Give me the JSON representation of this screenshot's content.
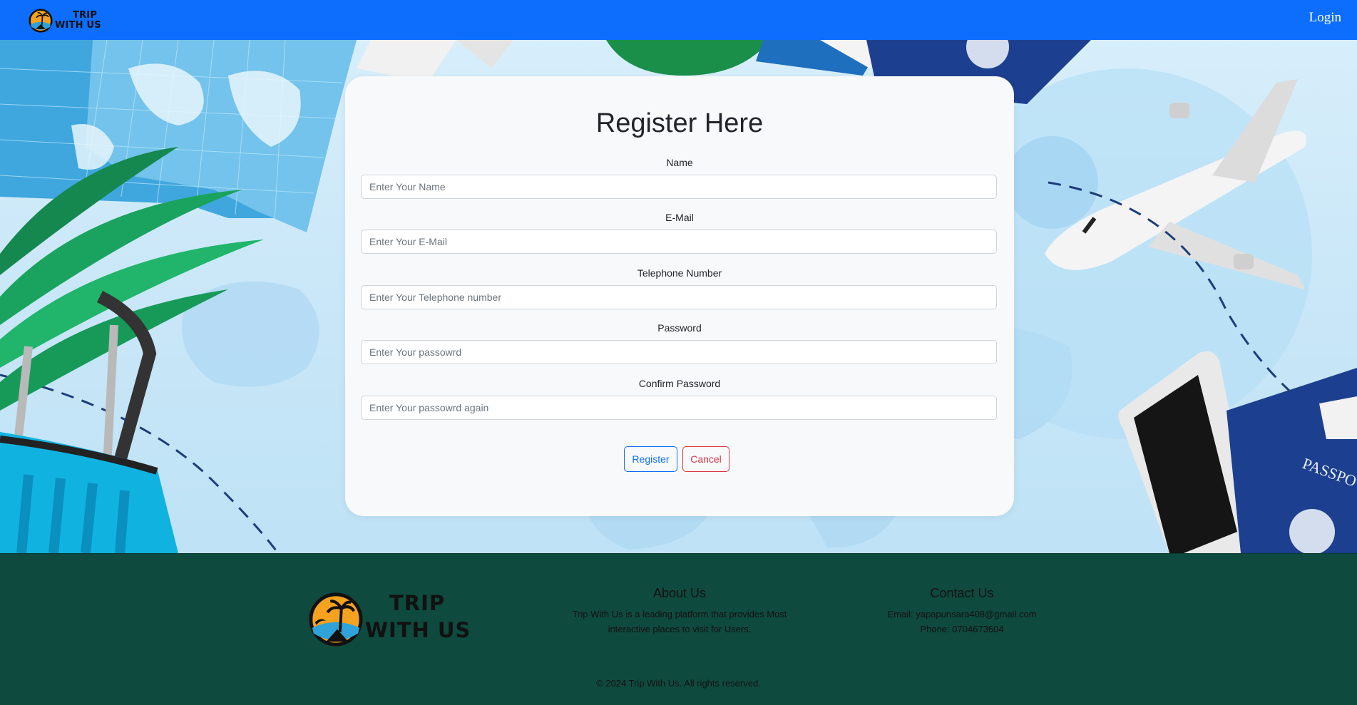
{
  "navbar": {
    "logo_line1": "TRIP",
    "logo_line2": "WITH US",
    "login_label": "Login",
    "bg_color": "#0d6efd"
  },
  "form": {
    "title": "Register Here",
    "fields": [
      {
        "label": "Name",
        "placeholder": "Enter Your Name",
        "value": ""
      },
      {
        "label": "E-Mail",
        "placeholder": "Enter Your E-Mail",
        "value": ""
      },
      {
        "label": "Telephone Number",
        "placeholder": "Enter Your Telephone number",
        "value": ""
      },
      {
        "label": "Password",
        "placeholder": "Enter Your passowrd",
        "value": ""
      },
      {
        "label": "Confirm Password",
        "placeholder": "Enter Your passowrd again",
        "value": ""
      }
    ],
    "register_label": "Register",
    "cancel_label": "Cancel"
  },
  "footer": {
    "logo_line1": "TRIP",
    "logo_line2": "WITH US",
    "about_title": "About Us",
    "about_text": "Trip With Us is a leading platform that provides Most interactive places to visit for Users.",
    "contact_title": "Contact Us",
    "contact_email": "Email: yapapunsara408@gmail.com",
    "contact_phone": "Phone: 0704673604",
    "copyright": "© 2024 Trip With Us. All rights reserved.",
    "bg_color": "#0f4a3f"
  },
  "colors": {
    "primary": "#0d6efd",
    "danger": "#dc3545",
    "card_bg": "#f8f9fa"
  }
}
